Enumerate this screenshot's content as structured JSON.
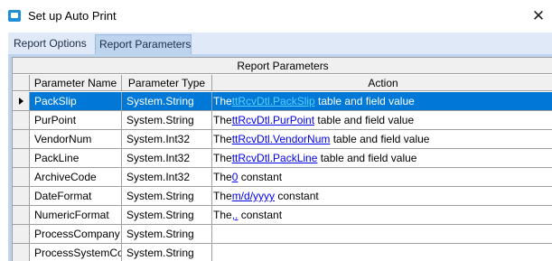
{
  "window": {
    "title": "Set up Auto Print",
    "close_glyph": "✕"
  },
  "tabs": [
    {
      "label": "Report Options"
    },
    {
      "label": "Report Parameters"
    }
  ],
  "grid": {
    "band_title": "Report Parameters",
    "columns": [
      "Parameter Name",
      "Parameter Type",
      "Action"
    ],
    "rows": [
      {
        "name": "PackSlip",
        "type": "System.String",
        "prefix": "The",
        "link": "ttRcvDtl.PackSlip",
        "suffix": " table and field value"
      },
      {
        "name": "PurPoint",
        "type": "System.String",
        "prefix": "The",
        "link": "ttRcvDtl.PurPoint",
        "suffix": " table and field value"
      },
      {
        "name": "VendorNum",
        "type": "System.Int32",
        "prefix": "The",
        "link": "ttRcvDtl.VendorNum",
        "suffix": " table and field value"
      },
      {
        "name": "PackLine",
        "type": "System.Int32",
        "prefix": "The",
        "link": "ttRcvDtl.PackLine",
        "suffix": " table and field value"
      },
      {
        "name": "ArchiveCode",
        "type": "System.Int32",
        "prefix": "The",
        "link": "0",
        "suffix": " constant"
      },
      {
        "name": "DateFormat",
        "type": "System.String",
        "prefix": "The",
        "link": "m/d/yyyy",
        "suffix": " constant"
      },
      {
        "name": "NumericFormat",
        "type": "System.String",
        "prefix": "The",
        "link": ",.",
        "suffix": " constant"
      },
      {
        "name": "ProcessCompany",
        "type": "System.String",
        "prefix": "",
        "link": "",
        "suffix": ""
      },
      {
        "name": "ProcessSystemCo",
        "type": "System.String",
        "prefix": "",
        "link": "",
        "suffix": ""
      }
    ],
    "selected_row": 0
  },
  "colors": {
    "selection": "#0078d7",
    "tab_bg": "#dfe9f7",
    "panel_bg": "#bcd4ee",
    "link": "#0000ee"
  },
  "icons": {
    "app": "app-window-icon",
    "close": "close-icon",
    "row_indicator": "row-pointer-icon"
  }
}
